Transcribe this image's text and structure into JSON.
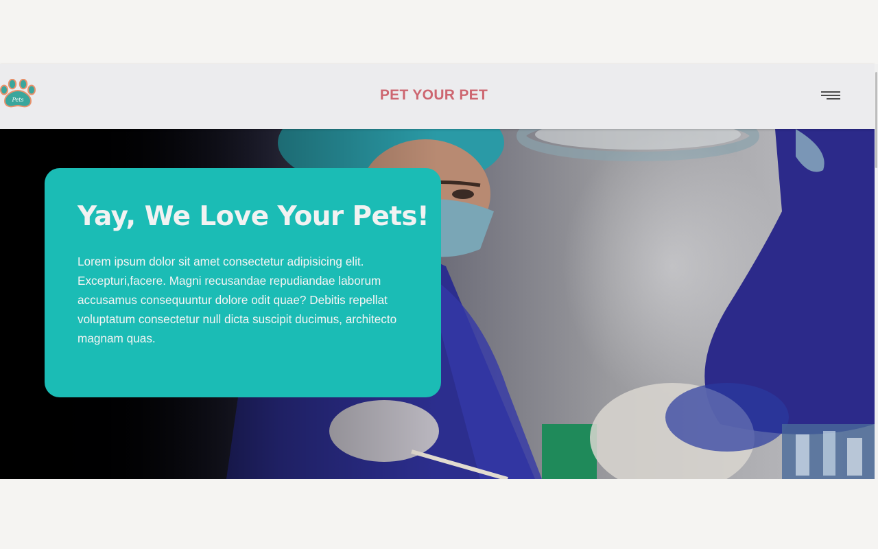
{
  "navbar": {
    "logo_text": "Pets",
    "brand": "PET YOUR PET",
    "menu_icon": "hamburger-menu-icon"
  },
  "hero": {
    "title": "Yay, We Love Your Pets!",
    "text": "Lorem ipsum dolor sit amet consectetur adipisicing elit. Excepturi,facere. Magni recusandae repudiandae laborum accusamus consequuntur dolore odit quae? Debitis repellat voluptatum consectetur null dicta suscipit ducimus, architecto magnam quas.",
    "image": "veterinary-surgeons-photo"
  },
  "colors": {
    "brand": "#cd6670",
    "card": "#1bbcb5",
    "navbar": "#ececee",
    "page": "#f5f4f2",
    "logo_teal": "#3aa69c",
    "logo_outline": "#e8916b"
  }
}
